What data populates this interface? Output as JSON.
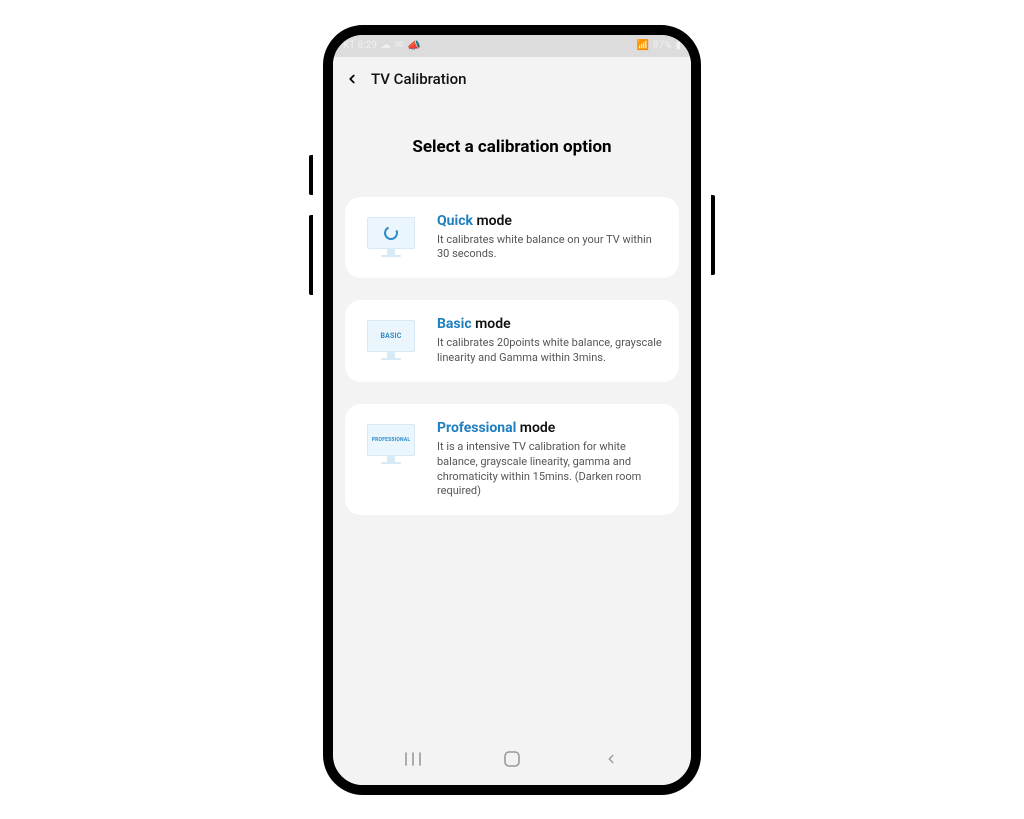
{
  "status": {
    "left_time": "KT 8:29",
    "right_text": "87%"
  },
  "header": {
    "title": "TV Calibration"
  },
  "page": {
    "heading": "Select a calibration option"
  },
  "options": [
    {
      "accent": "Quick",
      "rest": " mode",
      "desc": "It calibrates white balance on your TV within 30 seconds.",
      "icon_label": ""
    },
    {
      "accent": "Basic",
      "rest": " mode",
      "desc": "It calibrates 20points white balance, grayscale linearity and Gamma within 3mins.",
      "icon_label": "BASIC"
    },
    {
      "accent": "Professional",
      "rest": " mode",
      "desc": "It is a intensive TV calibration for white balance, grayscale linearity, gamma and chromaticity within 15mins. (Darken room required)",
      "icon_label": "PROFESSIONAL"
    }
  ]
}
